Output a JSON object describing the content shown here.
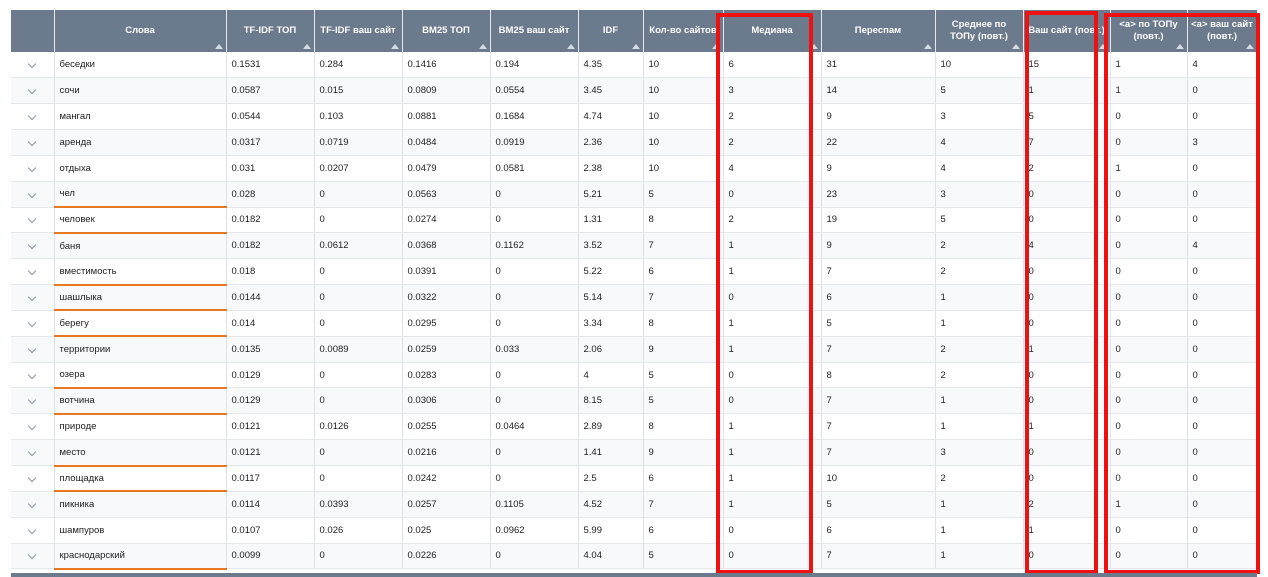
{
  "headers": [
    {
      "key": "expand",
      "label": ""
    },
    {
      "key": "word",
      "label": "Слова"
    },
    {
      "key": "tfidf_top",
      "label": "TF-IDF ТОП"
    },
    {
      "key": "tfidf_site",
      "label": "TF-IDF ваш сайт"
    },
    {
      "key": "bm25_top",
      "label": "BM25 ТОП"
    },
    {
      "key": "bm25_site",
      "label": "BM25 ваш сайт"
    },
    {
      "key": "idf",
      "label": "IDF"
    },
    {
      "key": "sites",
      "label": "Кол-во сайтов"
    },
    {
      "key": "median",
      "label": "Медиана"
    },
    {
      "key": "overspam",
      "label": "Переспам"
    },
    {
      "key": "avg_top",
      "label": "Среднее по ТОПу (повт.)"
    },
    {
      "key": "your_site",
      "label": "Ваш сайт (повт.)"
    },
    {
      "key": "a_top",
      "label": "<a> по ТОПу (повт.)"
    },
    {
      "key": "a_site",
      "label": "<a> ваш сайт (повт.)"
    }
  ],
  "rows": [
    {
      "word": "беседки",
      "tfidf_top": "0.1531",
      "tfidf_site": "0.284",
      "bm25_top": "0.1416",
      "bm25_site": "0.194",
      "idf": "4.35",
      "sites": "10",
      "median": "6",
      "overspam": "31",
      "avg_top": "10",
      "your_site": "15",
      "a_top": "1",
      "a_site": "4",
      "orange": false
    },
    {
      "word": "сочи",
      "tfidf_top": "0.0587",
      "tfidf_site": "0.015",
      "bm25_top": "0.0809",
      "bm25_site": "0.0554",
      "idf": "3.45",
      "sites": "10",
      "median": "3",
      "overspam": "14",
      "avg_top": "5",
      "your_site": "1",
      "a_top": "1",
      "a_site": "0",
      "orange": false
    },
    {
      "word": "мангал",
      "tfidf_top": "0.0544",
      "tfidf_site": "0.103",
      "bm25_top": "0.0881",
      "bm25_site": "0.1684",
      "idf": "4.74",
      "sites": "10",
      "median": "2",
      "overspam": "9",
      "avg_top": "3",
      "your_site": "5",
      "a_top": "0",
      "a_site": "0",
      "orange": false
    },
    {
      "word": "аренда",
      "tfidf_top": "0.0317",
      "tfidf_site": "0.0719",
      "bm25_top": "0.0484",
      "bm25_site": "0.0919",
      "idf": "2.36",
      "sites": "10",
      "median": "2",
      "overspam": "22",
      "avg_top": "4",
      "your_site": "7",
      "a_top": "0",
      "a_site": "3",
      "orange": false
    },
    {
      "word": "отдыха",
      "tfidf_top": "0.031",
      "tfidf_site": "0.0207",
      "bm25_top": "0.0479",
      "bm25_site": "0.0581",
      "idf": "2.38",
      "sites": "10",
      "median": "4",
      "overspam": "9",
      "avg_top": "4",
      "your_site": "2",
      "a_top": "1",
      "a_site": "0",
      "orange": false
    },
    {
      "word": "чел",
      "tfidf_top": "0.028",
      "tfidf_site": "0",
      "bm25_top": "0.0563",
      "bm25_site": "0",
      "idf": "5.21",
      "sites": "5",
      "median": "0",
      "overspam": "23",
      "avg_top": "3",
      "your_site": "0",
      "a_top": "0",
      "a_site": "0",
      "orange": true
    },
    {
      "word": "человек",
      "tfidf_top": "0.0182",
      "tfidf_site": "0",
      "bm25_top": "0.0274",
      "bm25_site": "0",
      "idf": "1.31",
      "sites": "8",
      "median": "2",
      "overspam": "19",
      "avg_top": "5",
      "your_site": "0",
      "a_top": "0",
      "a_site": "0",
      "orange": true
    },
    {
      "word": "баня",
      "tfidf_top": "0.0182",
      "tfidf_site": "0.0612",
      "bm25_top": "0.0368",
      "bm25_site": "0.1162",
      "idf": "3.52",
      "sites": "7",
      "median": "1",
      "overspam": "9",
      "avg_top": "2",
      "your_site": "4",
      "a_top": "0",
      "a_site": "4",
      "orange": false
    },
    {
      "word": "вместимость",
      "tfidf_top": "0.018",
      "tfidf_site": "0",
      "bm25_top": "0.0391",
      "bm25_site": "0",
      "idf": "5.22",
      "sites": "6",
      "median": "1",
      "overspam": "7",
      "avg_top": "2",
      "your_site": "0",
      "a_top": "0",
      "a_site": "0",
      "orange": true
    },
    {
      "word": "шашлыка",
      "tfidf_top": "0.0144",
      "tfidf_site": "0",
      "bm25_top": "0.0322",
      "bm25_site": "0",
      "idf": "5.14",
      "sites": "7",
      "median": "0",
      "overspam": "6",
      "avg_top": "1",
      "your_site": "0",
      "a_top": "0",
      "a_site": "0",
      "orange": true
    },
    {
      "word": "берегу",
      "tfidf_top": "0.014",
      "tfidf_site": "0",
      "bm25_top": "0.0295",
      "bm25_site": "0",
      "idf": "3.34",
      "sites": "8",
      "median": "1",
      "overspam": "5",
      "avg_top": "1",
      "your_site": "0",
      "a_top": "0",
      "a_site": "0",
      "orange": true
    },
    {
      "word": "территории",
      "tfidf_top": "0.0135",
      "tfidf_site": "0.0089",
      "bm25_top": "0.0259",
      "bm25_site": "0.033",
      "idf": "2.06",
      "sites": "9",
      "median": "1",
      "overspam": "7",
      "avg_top": "2",
      "your_site": "1",
      "a_top": "0",
      "a_site": "0",
      "orange": false
    },
    {
      "word": "озера",
      "tfidf_top": "0.0129",
      "tfidf_site": "0",
      "bm25_top": "0.0283",
      "bm25_site": "0",
      "idf": "4",
      "sites": "5",
      "median": "0",
      "overspam": "8",
      "avg_top": "2",
      "your_site": "0",
      "a_top": "0",
      "a_site": "0",
      "orange": true
    },
    {
      "word": "вотчина",
      "tfidf_top": "0.0129",
      "tfidf_site": "0",
      "bm25_top": "0.0306",
      "bm25_site": "0",
      "idf": "8.15",
      "sites": "5",
      "median": "0",
      "overspam": "7",
      "avg_top": "1",
      "your_site": "0",
      "a_top": "0",
      "a_site": "0",
      "orange": true
    },
    {
      "word": "природе",
      "tfidf_top": "0.0121",
      "tfidf_site": "0.0126",
      "bm25_top": "0.0255",
      "bm25_site": "0.0464",
      "idf": "2.89",
      "sites": "8",
      "median": "1",
      "overspam": "7",
      "avg_top": "1",
      "your_site": "1",
      "a_top": "0",
      "a_site": "0",
      "orange": false
    },
    {
      "word": "место",
      "tfidf_top": "0.0121",
      "tfidf_site": "0",
      "bm25_top": "0.0216",
      "bm25_site": "0",
      "idf": "1.41",
      "sites": "9",
      "median": "1",
      "overspam": "7",
      "avg_top": "3",
      "your_site": "0",
      "a_top": "0",
      "a_site": "0",
      "orange": true
    },
    {
      "word": "площадка",
      "tfidf_top": "0.0117",
      "tfidf_site": "0",
      "bm25_top": "0.0242",
      "bm25_site": "0",
      "idf": "2.5",
      "sites": "6",
      "median": "1",
      "overspam": "10",
      "avg_top": "2",
      "your_site": "0",
      "a_top": "0",
      "a_site": "0",
      "orange": true
    },
    {
      "word": "пикника",
      "tfidf_top": "0.0114",
      "tfidf_site": "0.0393",
      "bm25_top": "0.0257",
      "bm25_site": "0.1105",
      "idf": "4.52",
      "sites": "7",
      "median": "1",
      "overspam": "5",
      "avg_top": "1",
      "your_site": "2",
      "a_top": "1",
      "a_site": "0",
      "orange": false
    },
    {
      "word": "шампуров",
      "tfidf_top": "0.0107",
      "tfidf_site": "0.026",
      "bm25_top": "0.025",
      "bm25_site": "0.0962",
      "idf": "5.99",
      "sites": "6",
      "median": "0",
      "overspam": "6",
      "avg_top": "1",
      "your_site": "1",
      "a_top": "0",
      "a_site": "0",
      "orange": false
    },
    {
      "word": "краснодарский",
      "tfidf_top": "0.0099",
      "tfidf_site": "0",
      "bm25_top": "0.0226",
      "bm25_site": "0",
      "idf": "4.04",
      "sites": "5",
      "median": "0",
      "overspam": "7",
      "avg_top": "1",
      "your_site": "0",
      "a_top": "0",
      "a_site": "0",
      "orange": true
    }
  ],
  "colors": {
    "header_bg": "#6b7a8c",
    "highlight": "#ee1111",
    "orange_underline": "#e87722"
  },
  "icons": {
    "expand": "chevron-down-icon",
    "sort": "sort-arrow-icon"
  }
}
